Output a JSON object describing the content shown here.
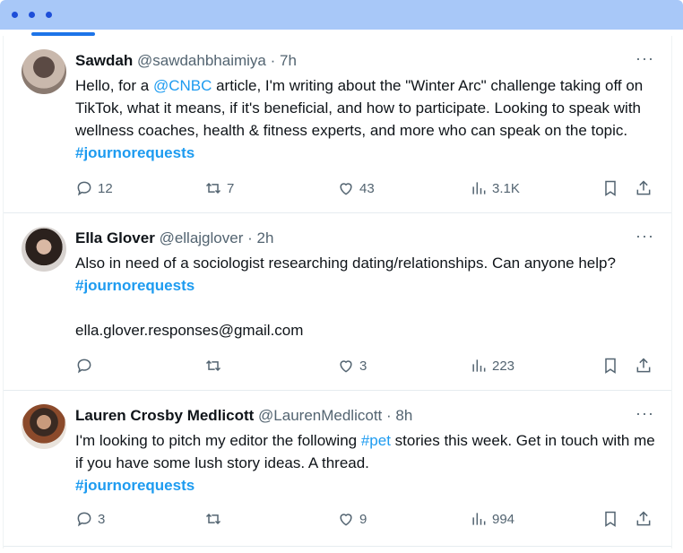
{
  "tweets": [
    {
      "name": "Sawdah",
      "handle": "@sawdahbhaimiya",
      "sep": "·",
      "time": "7h",
      "text_parts": {
        "a": "Hello, for a ",
        "mention": "@CNBC",
        "b": " article, I'm writing about the \"Winter Arc\" challenge taking off on TikTok, what it means, if it's beneficial, and how to participate. Looking to speak with wellness coaches, health & fitness experts, and more who can speak on the topic. ",
        "hashtag": "#journorequests"
      },
      "replies": "12",
      "retweets": "7",
      "likes": "43",
      "views": "3.1K"
    },
    {
      "name": "Ella Glover",
      "handle": "@ellajglover",
      "sep": "·",
      "time": "2h",
      "text_parts": {
        "a": "Also in need of a sociologist researching dating/relationships. Can anyone help? ",
        "hashtag": "#journorequests",
        "email": "ella.glover.responses@gmail.com"
      },
      "replies": "",
      "retweets": "",
      "likes": "3",
      "views": "223"
    },
    {
      "name": "Lauren Crosby Medlicott",
      "handle": "@LaurenMedlicott",
      "sep": "·",
      "time": "8h",
      "text_parts": {
        "a": "I'm looking to pitch my editor the following ",
        "tag": "#pet",
        "b": " stories this week. Get in touch with me if you have some lush story ideas. A thread.",
        "hashtag": "#journorequests"
      },
      "replies": "3",
      "retweets": "",
      "likes": "9",
      "views": "994"
    }
  ],
  "more_label": "···",
  "icons": {
    "reply": "reply-icon",
    "retweet": "retweet-icon",
    "like": "heart-icon",
    "views": "views-icon",
    "bookmark": "bookmark-icon",
    "share": "share-icon"
  },
  "colors": {
    "window_bar": "#a8c8f8",
    "accent": "#1d9bf0",
    "muted": "#536471"
  }
}
